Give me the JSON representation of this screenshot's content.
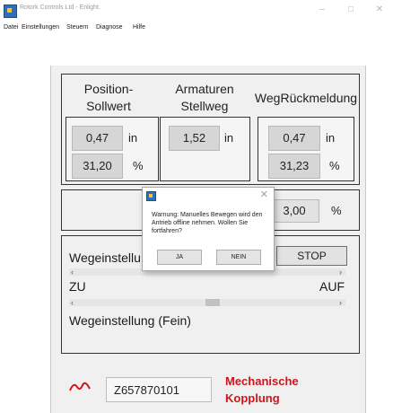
{
  "window": {
    "title": "Rotork Controls Ltd - Enlight.",
    "minimize": "–",
    "maximize": "□",
    "close": "✕"
  },
  "menu": [
    "Datei",
    "Einstellungen",
    "Steuern",
    "Diagnose",
    "Hilfe"
  ],
  "headers": {
    "position": "Position-\nSollwert",
    "armaturen": "Armaturen\nStellweg",
    "feedback": "WegRückmeldung"
  },
  "position": {
    "value_in": "0,47",
    "unit_in": "in",
    "value_pct": "31,20",
    "unit_pct": "%"
  },
  "armaturen": {
    "value_in": "1,52",
    "unit_in": "in"
  },
  "feedback": {
    "value_in": "0,47",
    "unit_in": "in",
    "value_pct": "31,23",
    "unit_pct": "%"
  },
  "adjust": {
    "value": "3,00",
    "unit": "%"
  },
  "coarse": {
    "label": "Wegeinstellu",
    "left_label": "ZU",
    "right_label": "AUF",
    "stop_label": "STOP"
  },
  "fine": {
    "label": "Wegeinstellung (Fein)"
  },
  "dialog": {
    "message": "Warnung: Manuelles Bewegen wird den Antrieb offline nehmen. Wollen Sie fortfahren?",
    "yes_label": "JA",
    "no_label": "NEIN",
    "close": "✕"
  },
  "coupling": {
    "id": "Z657870101",
    "status": "Mechanische\nKopplung",
    "color": "#d0141b"
  },
  "colors": {
    "panel": "#f0f0f0",
    "field": "#d6d6d6",
    "accent": "#2f6fb8"
  }
}
